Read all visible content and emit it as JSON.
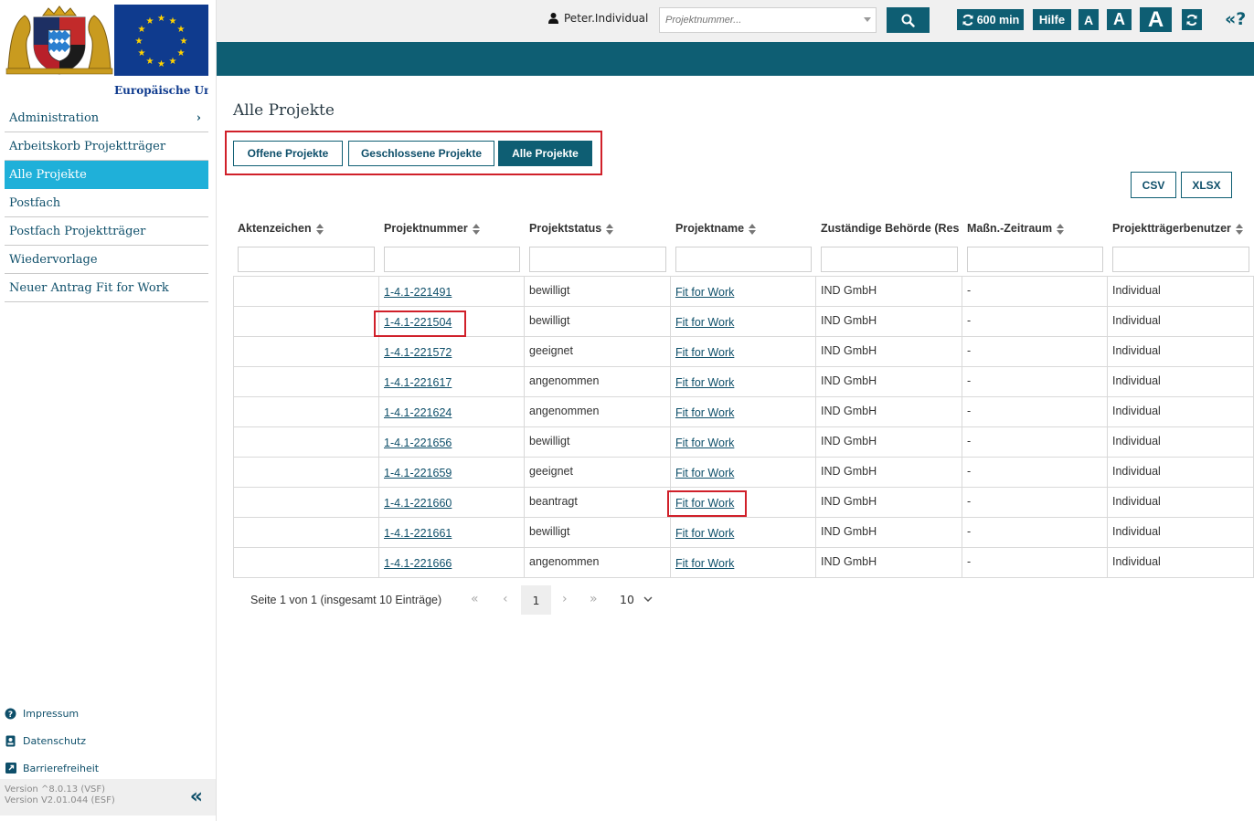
{
  "app": {
    "eu_caption": "Europäische Union"
  },
  "sidebar": {
    "items": [
      {
        "label": "Administration",
        "active": false,
        "has_chevron": true
      },
      {
        "label": "Arbeitskorb Projektträger",
        "active": false
      },
      {
        "label": "Alle Projekte",
        "active": true
      },
      {
        "label": "Postfach",
        "active": false
      },
      {
        "label": "Postfach Projektträger",
        "active": false
      },
      {
        "label": "Wiedervorlage",
        "active": false
      },
      {
        "label": "Neuer Antrag Fit for Work",
        "active": false
      }
    ],
    "footer_links": [
      {
        "label": "Impressum",
        "icon": "question-circle-icon"
      },
      {
        "label": "Datenschutz",
        "icon": "id-badge-icon"
      },
      {
        "label": "Barrierefreiheit",
        "icon": "external-link-icon"
      }
    ],
    "version_1": "Version ^8.0.13 (VSF)",
    "version_2": "Version V2.01.044 (ESF)"
  },
  "topbar": {
    "user": "Peter.Individual",
    "project_placeholder": "Projektnummer...",
    "session": "600 min",
    "help": "Hilfe",
    "font_small": "A",
    "font_medium": "A",
    "font_large": "A",
    "collapse_help": "«?"
  },
  "main": {
    "title": "Alle Projekte",
    "tabs": [
      {
        "label": "Offene Projekte",
        "active": false
      },
      {
        "label": "Geschlossene Projekte",
        "active": false
      },
      {
        "label": "Alle Projekte",
        "active": true
      }
    ],
    "export": {
      "csv": "CSV",
      "xlsx": "XLSX"
    }
  },
  "table": {
    "columns": [
      "Aktenzeichen",
      "Projektnummer",
      "Projektstatus",
      "Projektname",
      "Zuständige Behörde (Res",
      "Maßn.-Zeitraum",
      "Projektträgerbenutzer"
    ],
    "rows": [
      {
        "aktenzeichen": "",
        "projektnummer": "1-4.1-221491",
        "status": "bewilligt",
        "name": "Fit for Work",
        "behoerde": "IND GmbH",
        "zeitraum": "-",
        "benutzer": "Individual"
      },
      {
        "aktenzeichen": "",
        "projektnummer": "1-4.1-221504",
        "status": "bewilligt",
        "name": "Fit for Work",
        "behoerde": "IND GmbH",
        "zeitraum": "-",
        "benutzer": "Individual"
      },
      {
        "aktenzeichen": "",
        "projektnummer": "1-4.1-221572",
        "status": "geeignet",
        "name": "Fit for Work",
        "behoerde": "IND GmbH",
        "zeitraum": "-",
        "benutzer": "Individual"
      },
      {
        "aktenzeichen": "",
        "projektnummer": "1-4.1-221617",
        "status": "angenommen",
        "name": "Fit for Work",
        "behoerde": "IND GmbH",
        "zeitraum": "-",
        "benutzer": "Individual"
      },
      {
        "aktenzeichen": "",
        "projektnummer": "1-4.1-221624",
        "status": "angenommen",
        "name": "Fit for Work",
        "behoerde": "IND GmbH",
        "zeitraum": "-",
        "benutzer": "Individual"
      },
      {
        "aktenzeichen": "",
        "projektnummer": "1-4.1-221656",
        "status": "bewilligt",
        "name": "Fit for Work",
        "behoerde": "IND GmbH",
        "zeitraum": "-",
        "benutzer": "Individual"
      },
      {
        "aktenzeichen": "",
        "projektnummer": "1-4.1-221659",
        "status": "geeignet",
        "name": "Fit for Work",
        "behoerde": "IND GmbH",
        "zeitraum": "-",
        "benutzer": "Individual"
      },
      {
        "aktenzeichen": "",
        "projektnummer": "1-4.1-221660",
        "status": "beantragt",
        "name": "Fit for Work",
        "behoerde": "IND GmbH",
        "zeitraum": "-",
        "benutzer": "Individual"
      },
      {
        "aktenzeichen": "",
        "projektnummer": "1-4.1-221661",
        "status": "bewilligt",
        "name": "Fit for Work",
        "behoerde": "IND GmbH",
        "zeitraum": "-",
        "benutzer": "Individual"
      },
      {
        "aktenzeichen": "",
        "projektnummer": "1-4.1-221666",
        "status": "angenommen",
        "name": "Fit for Work",
        "behoerde": "IND GmbH",
        "zeitraum": "-",
        "benutzer": "Individual"
      }
    ]
  },
  "pagination": {
    "summary": "Seite 1 von 1 (insgesamt 10 Einträge)",
    "current_page": "1",
    "page_size": "10"
  },
  "colors": {
    "primary": "#0e5e73",
    "active_nav": "#1fb0d9",
    "highlight": "#d0202a"
  }
}
